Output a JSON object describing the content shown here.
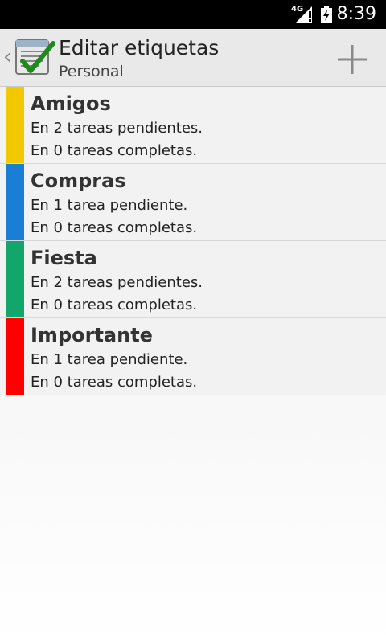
{
  "status_bar": {
    "network": "4G",
    "time": "8:39"
  },
  "action_bar": {
    "title": "Editar etiquetas",
    "subtitle": "Personal",
    "up_icon": "chevron-left-icon",
    "app_icon": "checklist-icon",
    "add_icon": "plus-icon"
  },
  "labels": [
    {
      "name": "Amigos",
      "pending": "En 2 tareas pendientes.",
      "completed": "En 0 tareas completas.",
      "color": "#f2c900"
    },
    {
      "name": "Compras",
      "pending": "En 1 tarea pendiente.",
      "completed": "En 0 tareas completas.",
      "color": "#1a7fd4"
    },
    {
      "name": "Fiesta",
      "pending": "En 2 tareas pendientes.",
      "completed": "En 0 tareas completas.",
      "color": "#12a66a"
    },
    {
      "name": "Importante",
      "pending": "En 1 tarea pendiente.",
      "completed": "En 0 tareas completas.",
      "color": "#ff0000"
    }
  ]
}
